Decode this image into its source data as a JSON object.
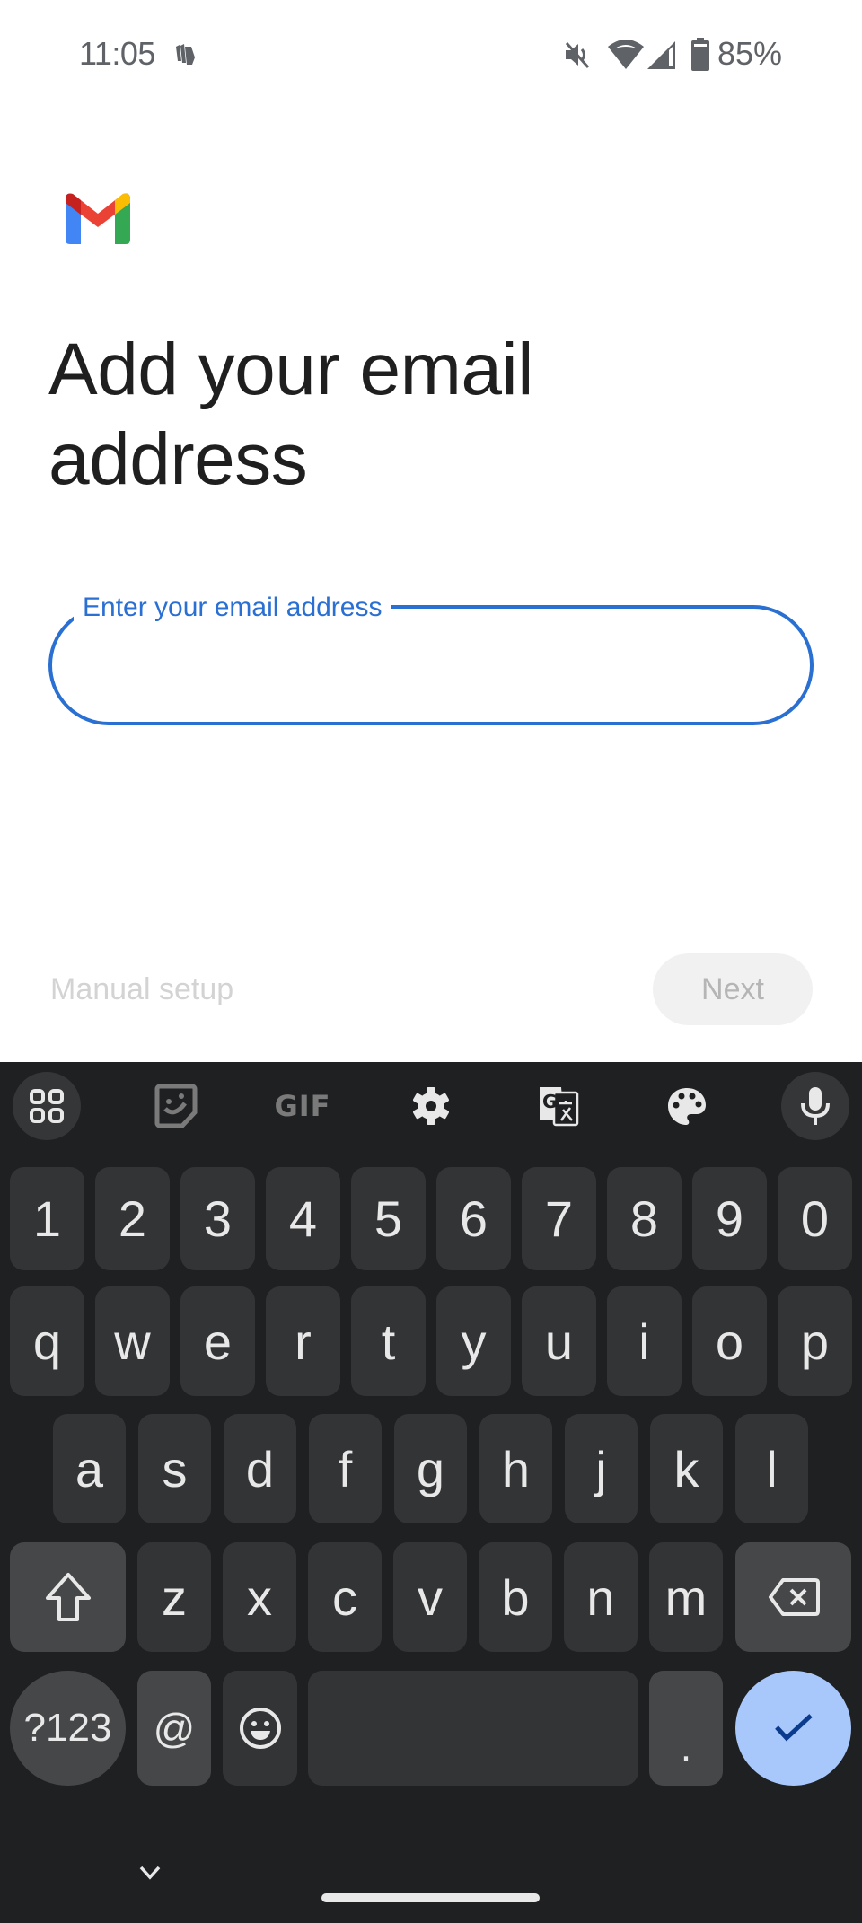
{
  "status_bar": {
    "time": "11:05",
    "notification_icon": "wallet-cards-icon",
    "icons": [
      "vibrate-off-icon",
      "wifi-icon",
      "cell-signal-icon",
      "battery-icon"
    ],
    "battery_percent": "85%"
  },
  "app": {
    "logo": "gmail-logo",
    "title": "Add your email address"
  },
  "email_field": {
    "label": "Enter your email address",
    "value": "",
    "focused": true,
    "accent_color": "#2a6fd2"
  },
  "actions": {
    "manual_setup_label": "Manual setup",
    "next_label": "Next",
    "next_enabled": false
  },
  "keyboard": {
    "toolbar": [
      {
        "name": "apps-grid-icon",
        "label": "Apps"
      },
      {
        "name": "sticker-icon",
        "label": "Stickers"
      },
      {
        "name": "gif-icon",
        "label": "GIF"
      },
      {
        "name": "settings-gear-icon",
        "label": "Settings"
      },
      {
        "name": "translate-icon",
        "label": "Translate"
      },
      {
        "name": "palette-icon",
        "label": "Theme"
      },
      {
        "name": "microphone-icon",
        "label": "Voice input"
      }
    ],
    "gif_text": "GIF",
    "rows": [
      [
        "1",
        "2",
        "3",
        "4",
        "5",
        "6",
        "7",
        "8",
        "9",
        "0"
      ],
      [
        "q",
        "w",
        "e",
        "r",
        "t",
        "y",
        "u",
        "i",
        "o",
        "p"
      ],
      [
        "a",
        "s",
        "d",
        "f",
        "g",
        "h",
        "j",
        "k",
        "l"
      ],
      [
        "z",
        "x",
        "c",
        "v",
        "b",
        "n",
        "m"
      ]
    ],
    "bottom_row": {
      "symbols_label": "?123",
      "at_label": "@",
      "emoji": "emoji-icon",
      "space_label": "",
      "period_label": ".",
      "enter": "check-icon"
    },
    "colors": {
      "background": "#1f2022",
      "key": "#333436",
      "special_key": "#464748",
      "enter": "#a8c7fa"
    }
  },
  "nav": {
    "hide_keyboard": "chevron-down-icon",
    "home_handle": "home-gesture-bar"
  }
}
